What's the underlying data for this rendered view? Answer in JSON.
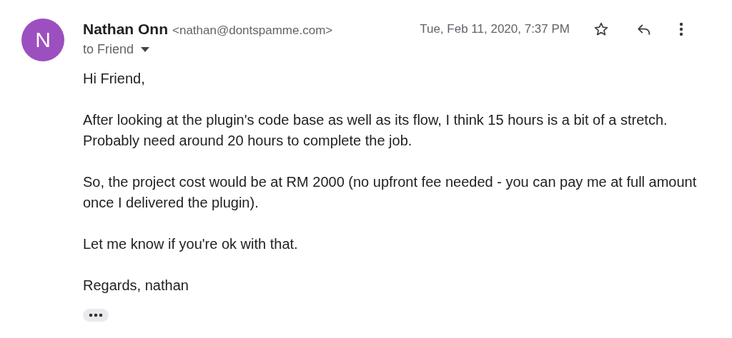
{
  "sender": {
    "avatar_letter": "N",
    "name": "Nathan Onn",
    "email": "<nathan@dontspamme.com>"
  },
  "recipient": "to Friend",
  "date": "Tue, Feb 11, 2020, 7:37 PM",
  "starred": false,
  "body": [
    "Hi Friend,",
    "After looking at the plugin's code base as well as its flow, I think 15 hours is a bit of a stretch. Probably need around 20 hours to complete the job.",
    "So, the project cost would be at RM 2000 (no upfront fee needed - you can pay me at full amount once I delivered the plugin).",
    "Let me know if you're ok with that.",
    "Regards, nathan"
  ]
}
